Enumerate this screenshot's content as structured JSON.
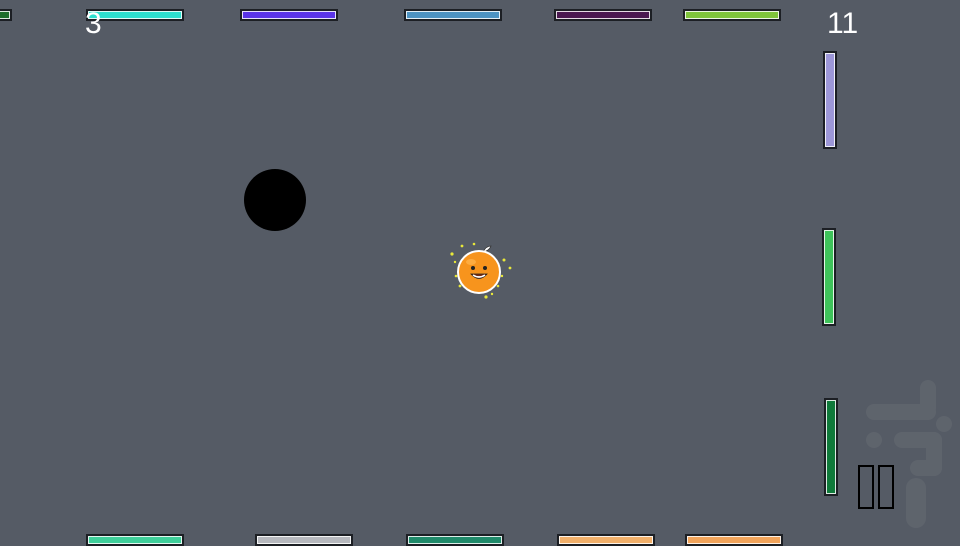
{
  "hud": {
    "score_left": "3",
    "score_right": "11"
  },
  "top_bars": [
    {
      "color": "#1f6e2c"
    },
    {
      "color": "#2de0cf"
    },
    {
      "color": "#5a33e8"
    },
    {
      "color": "#4d93c2"
    },
    {
      "color": "#4a1850"
    },
    {
      "color": "#7fc43a"
    }
  ],
  "bottom_bars": [
    {
      "color": "#3fcf9a"
    },
    {
      "color": "#b7b9be"
    },
    {
      "color": "#1f8a6a"
    },
    {
      "color": "#f2b06a"
    },
    {
      "color": "#f2a45a"
    }
  ],
  "side_bars": [
    {
      "color": "#9d97d8"
    },
    {
      "color": "#3ec35a"
    },
    {
      "color": "#0f7a3a"
    }
  ],
  "ball": {
    "color": "#000000"
  },
  "player": {
    "icon": "smiling-orange-icon"
  },
  "controls": {
    "pause_icon": "pause-icon"
  },
  "watermark": {
    "icon": "store-logo-icon"
  }
}
